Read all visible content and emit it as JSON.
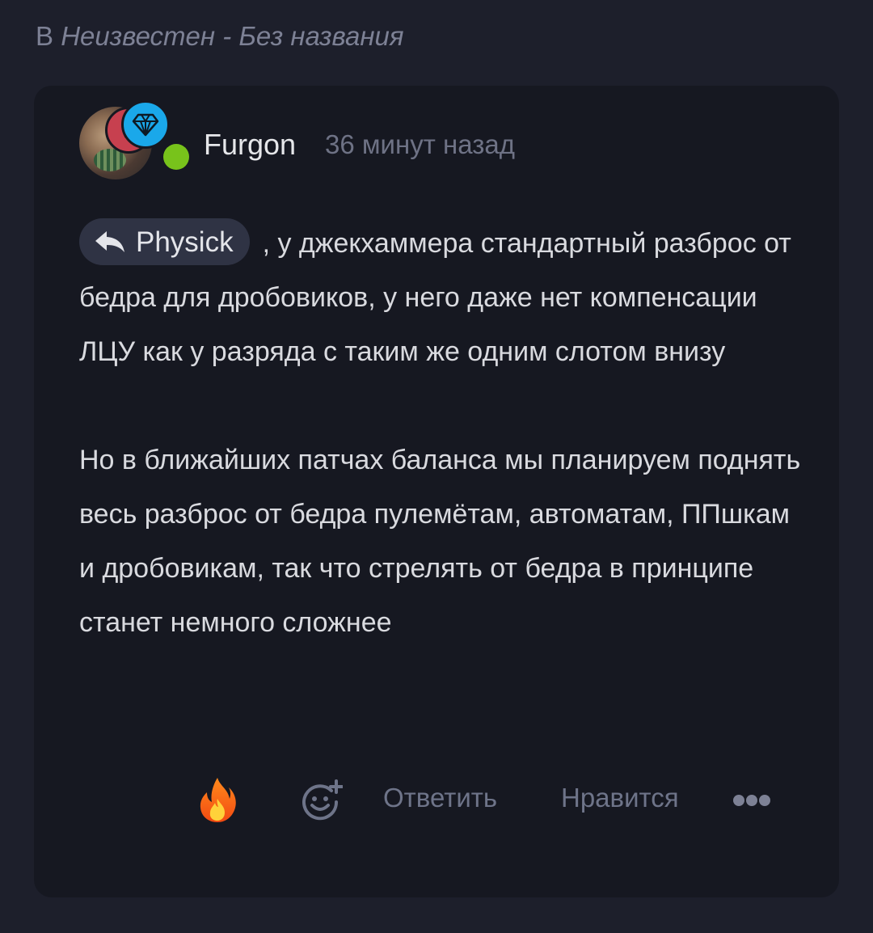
{
  "context": {
    "prefix": "В",
    "link_text": "Неизвестен - Без названия"
  },
  "comment": {
    "author": "Furgon",
    "timestamp": "36 минут назад",
    "mention": "Physick",
    "paragraphs": [
      ", у джекхаммера стандартный разброс от бедра для дробовиков, у него даже нет компенсации ЛЦУ как у разряда с таким же одним слотом внизу",
      "Но в ближайших патчах баланса мы планируем поднять весь разброс от бедра пулемётам, автоматам, ППшкам и дробовикам, так что стрелять от бедра в принципе станет немного сложнее"
    ],
    "avatar_badges": [
      "red-badge-icon",
      "diamond-icon"
    ],
    "online_status_color": "#78c31b"
  },
  "actions": {
    "reaction_icon": "fire-icon",
    "add_reaction_icon": "emoji-add-icon",
    "reply_label": "Ответить",
    "like_label": "Нравится",
    "more_icon": "more-icon"
  },
  "colors": {
    "background": "#1d1f2b",
    "card": "#161821",
    "mention_bg": "#2f3344",
    "diamond_badge": "#1aa8ea",
    "red_badge": "#c7404f"
  }
}
